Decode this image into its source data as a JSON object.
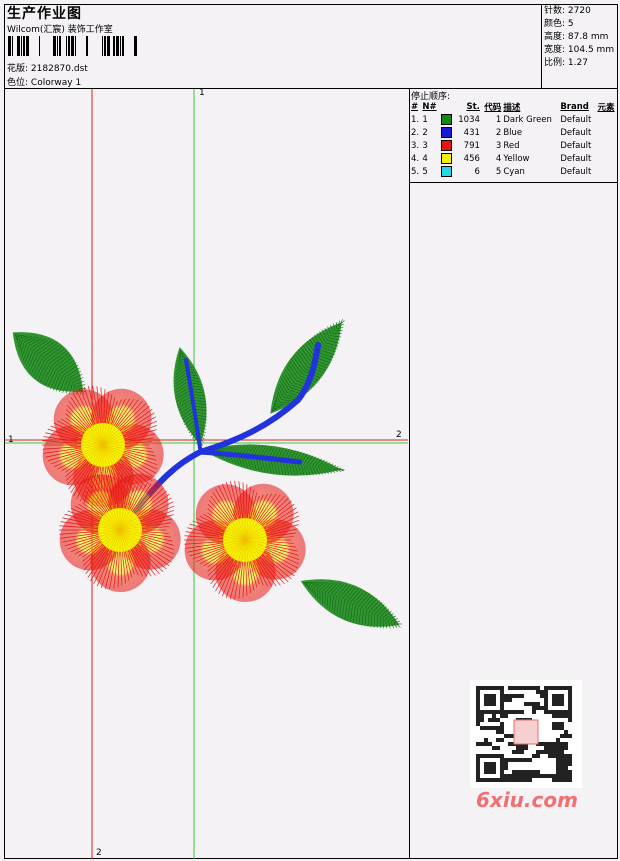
{
  "header": {
    "title": "生产作业图",
    "studio": "Wilcom(汇宸) 装饰工作室",
    "design_label": "花版:",
    "design_value": "2182870.dst",
    "colorway_label": "色位:",
    "colorway_value": "Colorway 1"
  },
  "stats": [
    {
      "label": "针数:",
      "value": "2720"
    },
    {
      "label": "颜色:",
      "value": "5"
    },
    {
      "label": "高度:",
      "value": "87.8 mm"
    },
    {
      "label": "宽度:",
      "value": "104.5 mm"
    },
    {
      "label": "比例:",
      "value": "1.27"
    }
  ],
  "stop_sequence": {
    "title": "停止顺序:",
    "headers": [
      "#",
      "N#",
      "St.",
      "代码",
      "描述",
      "Brand",
      "元素"
    ],
    "rows": [
      {
        "num": "1.",
        "n": "1",
        "color": "#128a12",
        "st": "1034",
        "code": "1",
        "desc": "Dark Green",
        "brand": "Default"
      },
      {
        "num": "2.",
        "n": "2",
        "color": "#1a1ad6",
        "st": "431",
        "code": "2",
        "desc": "Blue",
        "brand": "Default"
      },
      {
        "num": "3.",
        "n": "3",
        "color": "#e81414",
        "st": "791",
        "code": "3",
        "desc": "Red",
        "brand": "Default"
      },
      {
        "num": "4.",
        "n": "4",
        "color": "#f2f200",
        "st": "456",
        "code": "4",
        "desc": "Yellow",
        "brand": "Default"
      },
      {
        "num": "5.",
        "n": "5",
        "color": "#22d8e6",
        "st": "6",
        "code": "5",
        "desc": "Cyan",
        "brand": "Default"
      }
    ]
  },
  "axes": {
    "top_label": "1",
    "left_label": "1",
    "right_label": "2",
    "bottom_label": "2"
  },
  "colors": {
    "guide_red": "#e02020",
    "guide_green": "#33cc33",
    "leaf": "#1e8a1e",
    "stem": "#2233dd",
    "petal": "#e81414",
    "center": "#f4f400"
  },
  "watermark": "6xiu.com"
}
